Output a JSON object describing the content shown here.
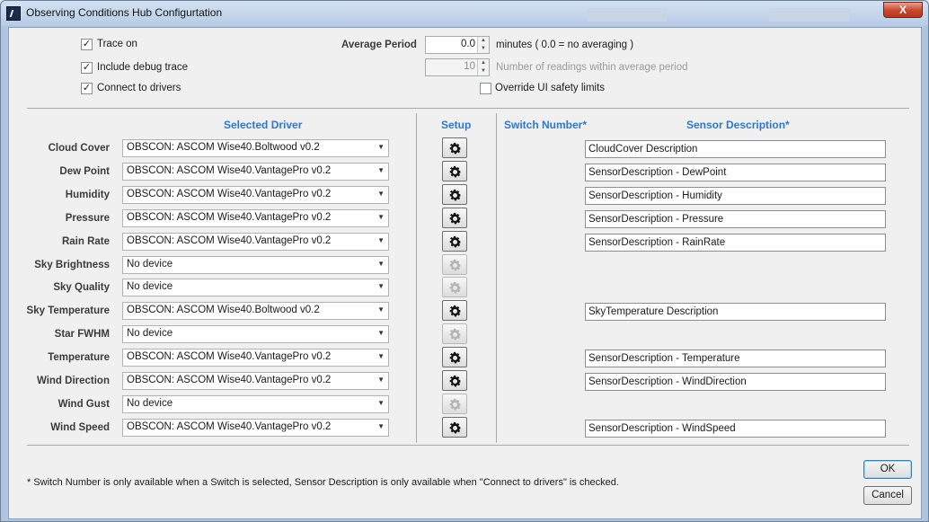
{
  "window": {
    "title": "Observing Conditions Hub Configurtation",
    "close_label": "X"
  },
  "options": {
    "trace_on": {
      "label": "Trace on",
      "checked": true
    },
    "debug_trace": {
      "label": "Include debug trace",
      "checked": true
    },
    "connect_drivers": {
      "label": "Connect to drivers",
      "checked": true
    },
    "override_limits": {
      "label": "Override UI safety limits",
      "checked": false
    },
    "average_period_label": "Average Period",
    "average_period_value": "0.0",
    "average_period_unit": "minutes ( 0.0 = no averaging )",
    "readings_value": "10",
    "readings_label": "Number of readings within average period"
  },
  "columns": {
    "selected_driver": "Selected Driver",
    "setup": "Setup",
    "switch_number": "Switch Number*",
    "sensor_description": "Sensor Description*"
  },
  "sensors": [
    {
      "label": "Cloud Cover",
      "driver": "OBSCON: ASCOM Wise40.Boltwood v0.2",
      "setup_enabled": true,
      "description": "CloudCover Description"
    },
    {
      "label": "Dew Point",
      "driver": "OBSCON: ASCOM Wise40.VantagePro v0.2",
      "setup_enabled": true,
      "description": "SensorDescription - DewPoint"
    },
    {
      "label": "Humidity",
      "driver": "OBSCON: ASCOM Wise40.VantagePro v0.2",
      "setup_enabled": true,
      "description": "SensorDescription - Humidity"
    },
    {
      "label": "Pressure",
      "driver": "OBSCON: ASCOM Wise40.VantagePro v0.2",
      "setup_enabled": true,
      "description": "SensorDescription - Pressure"
    },
    {
      "label": "Rain Rate",
      "driver": "OBSCON: ASCOM Wise40.VantagePro v0.2",
      "setup_enabled": true,
      "description": "SensorDescription - RainRate"
    },
    {
      "label": "Sky Brightness",
      "driver": "No device",
      "setup_enabled": false,
      "description": ""
    },
    {
      "label": "Sky Quality",
      "driver": "No device",
      "setup_enabled": false,
      "description": ""
    },
    {
      "label": "Sky Temperature",
      "driver": "OBSCON: ASCOM Wise40.Boltwood v0.2",
      "setup_enabled": true,
      "description": "SkyTemperature Description"
    },
    {
      "label": "Star FWHM",
      "driver": "No device",
      "setup_enabled": false,
      "description": ""
    },
    {
      "label": "Temperature",
      "driver": "OBSCON: ASCOM Wise40.VantagePro v0.2",
      "setup_enabled": true,
      "description": "SensorDescription - Temperature"
    },
    {
      "label": "Wind Direction",
      "driver": "OBSCON: ASCOM Wise40.VantagePro v0.2",
      "setup_enabled": true,
      "description": "SensorDescription - WindDirection"
    },
    {
      "label": "Wind Gust",
      "driver": "No device",
      "setup_enabled": false,
      "description": ""
    },
    {
      "label": "Wind Speed",
      "driver": "OBSCON: ASCOM Wise40.VantagePro v0.2",
      "setup_enabled": true,
      "description": "SensorDescription - WindSpeed"
    }
  ],
  "footnote": "* Switch Number is only available when a Switch is selected, Sensor Description is only available when \"Connect to drivers\" is checked.",
  "buttons": {
    "ok": "OK",
    "cancel": "Cancel"
  },
  "colors": {
    "header_blue": "#2f78c9",
    "titlebar": "#bcd0e8",
    "close_red": "#c6452c"
  },
  "icons": {
    "setup": "gear-icon",
    "dropdown": "chevron-down-icon",
    "app": "app-icon"
  }
}
